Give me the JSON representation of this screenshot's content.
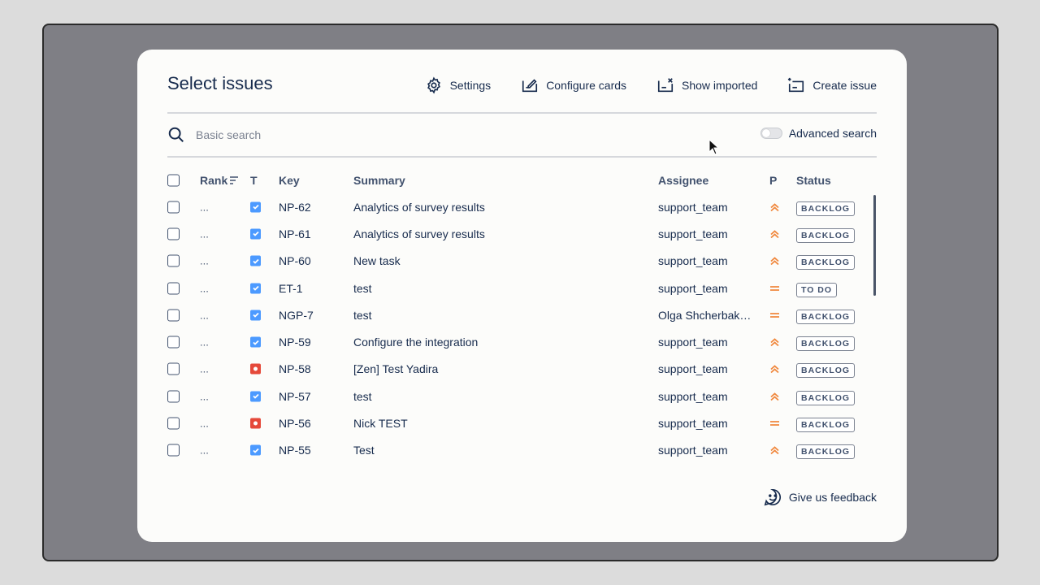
{
  "modal": {
    "title": "Select issues",
    "toolbar": {
      "settings": "Settings",
      "configure_cards": "Configure cards",
      "show_imported": "Show imported",
      "create_issue": "Create issue"
    },
    "search": {
      "placeholder": "Basic search",
      "advanced_label": "Advanced search",
      "advanced_enabled": false
    },
    "table": {
      "headers": {
        "rank": "Rank",
        "type": "T",
        "key": "Key",
        "summary": "Summary",
        "assignee": "Assignee",
        "priority": "P",
        "status": "Status"
      },
      "rows": [
        {
          "rank": "...",
          "type": "task",
          "key": "NP-62",
          "summary": "Analytics of survey results",
          "assignee": "support_team",
          "priority": "high",
          "status": "BACKLOG"
        },
        {
          "rank": "...",
          "type": "task",
          "key": "NP-61",
          "summary": "Analytics of survey results",
          "assignee": "support_team",
          "priority": "high",
          "status": "BACKLOG"
        },
        {
          "rank": "...",
          "type": "task",
          "key": "NP-60",
          "summary": "New task",
          "assignee": "support_team",
          "priority": "high",
          "status": "BACKLOG"
        },
        {
          "rank": "...",
          "type": "task",
          "key": "ET-1",
          "summary": "test",
          "assignee": "support_team",
          "priority": "medium",
          "status": "TO DO"
        },
        {
          "rank": "...",
          "type": "task",
          "key": "NGP-7",
          "summary": "test",
          "assignee": "Olga Shcherbako...",
          "priority": "medium",
          "status": "BACKLOG"
        },
        {
          "rank": "...",
          "type": "task",
          "key": "NP-59",
          "summary": "Configure the integration",
          "assignee": "support_team",
          "priority": "high",
          "status": "BACKLOG"
        },
        {
          "rank": "...",
          "type": "bug",
          "key": "NP-58",
          "summary": "[Zen] Test Yadira",
          "assignee": "support_team",
          "priority": "high",
          "status": "BACKLOG"
        },
        {
          "rank": "...",
          "type": "task",
          "key": "NP-57",
          "summary": "test",
          "assignee": "support_team",
          "priority": "high",
          "status": "BACKLOG"
        },
        {
          "rank": "...",
          "type": "bug",
          "key": "NP-56",
          "summary": "Nick TEST",
          "assignee": "support_team",
          "priority": "medium",
          "status": "BACKLOG"
        },
        {
          "rank": "...",
          "type": "task",
          "key": "NP-55",
          "summary": "Test",
          "assignee": "support_team",
          "priority": "high",
          "status": "BACKLOG"
        }
      ]
    },
    "feedback": "Give us feedback"
  },
  "colors": {
    "priority": "#f0883e",
    "task_icon": "#4c9aff",
    "bug_icon": "#e5493a",
    "backdrop": "#7f7f85"
  },
  "icons": {
    "settings": "gear-icon",
    "configure_cards": "card-edit-icon",
    "show_imported": "card-import-icon",
    "create_issue": "card-add-icon",
    "search": "search-icon",
    "feedback": "smiley-chat-icon",
    "priority_high": "double-chevron-up-icon",
    "priority_medium": "equals-icon"
  }
}
